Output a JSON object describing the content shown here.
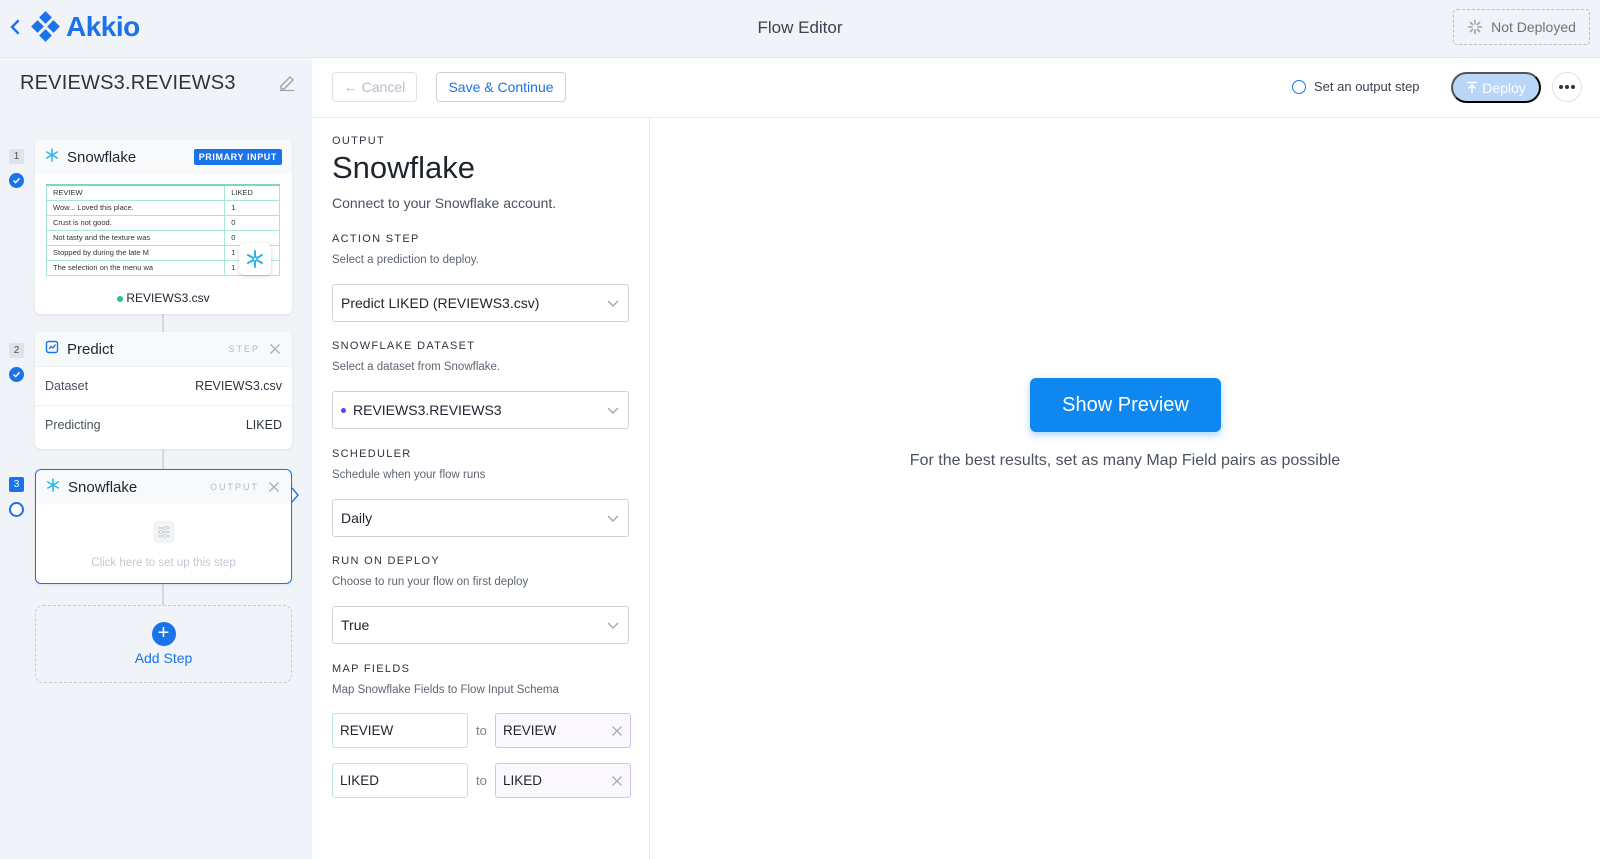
{
  "header": {
    "logo_text": "Akkio",
    "title": "Flow Editor",
    "deploy_status": "Not Deployed"
  },
  "sidebar": {
    "flow_name": "REVIEWS3.REVIEWS3",
    "steps": [
      {
        "number": "1",
        "title": "Snowflake",
        "badge": "PRIMARY INPUT",
        "preview_table": {
          "columns": [
            "REVIEW",
            "LIKED"
          ],
          "rows": [
            [
              "Wow... Loved this place.",
              "1"
            ],
            [
              "Crust is not good.",
              "0"
            ],
            [
              "Not tasty and the texture was",
              "0"
            ],
            [
              "Stopped by during the late M",
              "1"
            ],
            [
              "The selection on the menu wa",
              "1"
            ]
          ]
        },
        "file": "REVIEWS3.csv"
      },
      {
        "number": "2",
        "title": "Predict",
        "tag": "STEP",
        "rows": [
          {
            "label": "Dataset",
            "value": "REVIEWS3.csv"
          },
          {
            "label": "Predicting",
            "value": "LIKED"
          }
        ]
      },
      {
        "number": "3",
        "title": "Snowflake",
        "tag": "OUTPUT",
        "setup_hint": "Click here to set up this step"
      }
    ],
    "add_step_label": "Add Step"
  },
  "toolbar": {
    "cancel_label": "← Cancel",
    "save_label": "Save & Continue",
    "output_step_label": "Set an output step",
    "deploy_label": "Deploy"
  },
  "config": {
    "eyebrow": "OUTPUT",
    "title": "Snowflake",
    "subtitle": "Connect to your Snowflake account.",
    "action_step": {
      "label": "ACTION STEP",
      "hint": "Select a prediction to deploy.",
      "value": "Predict LIKED (REVIEWS3.csv)"
    },
    "dataset": {
      "label": "SNOWFLAKE DATASET",
      "hint": "Select a dataset from Snowflake.",
      "value": "REVIEWS3.REVIEWS3"
    },
    "scheduler": {
      "label": "SCHEDULER",
      "hint": "Schedule when your flow runs",
      "value": "Daily"
    },
    "run_on_deploy": {
      "label": "RUN ON DEPLOY",
      "hint": "Choose to run your flow on first deploy",
      "value": "True"
    },
    "map_fields": {
      "label": "MAP FIELDS",
      "hint": "Map Snowflake Fields to Flow Input Schema",
      "to_label": "to",
      "pairs": [
        {
          "from": "REVIEW",
          "to": "REVIEW"
        },
        {
          "from": "LIKED",
          "to": "LIKED"
        }
      ]
    }
  },
  "preview": {
    "button_label": "Show Preview",
    "hint": "For the best results, set as many Map Field pairs as possible"
  },
  "colors": {
    "accent": "#1a73e8",
    "preview_button": "#0f87f0",
    "input_border_green": "#b8e8d8",
    "input_border_purple": "#d3bff3"
  }
}
